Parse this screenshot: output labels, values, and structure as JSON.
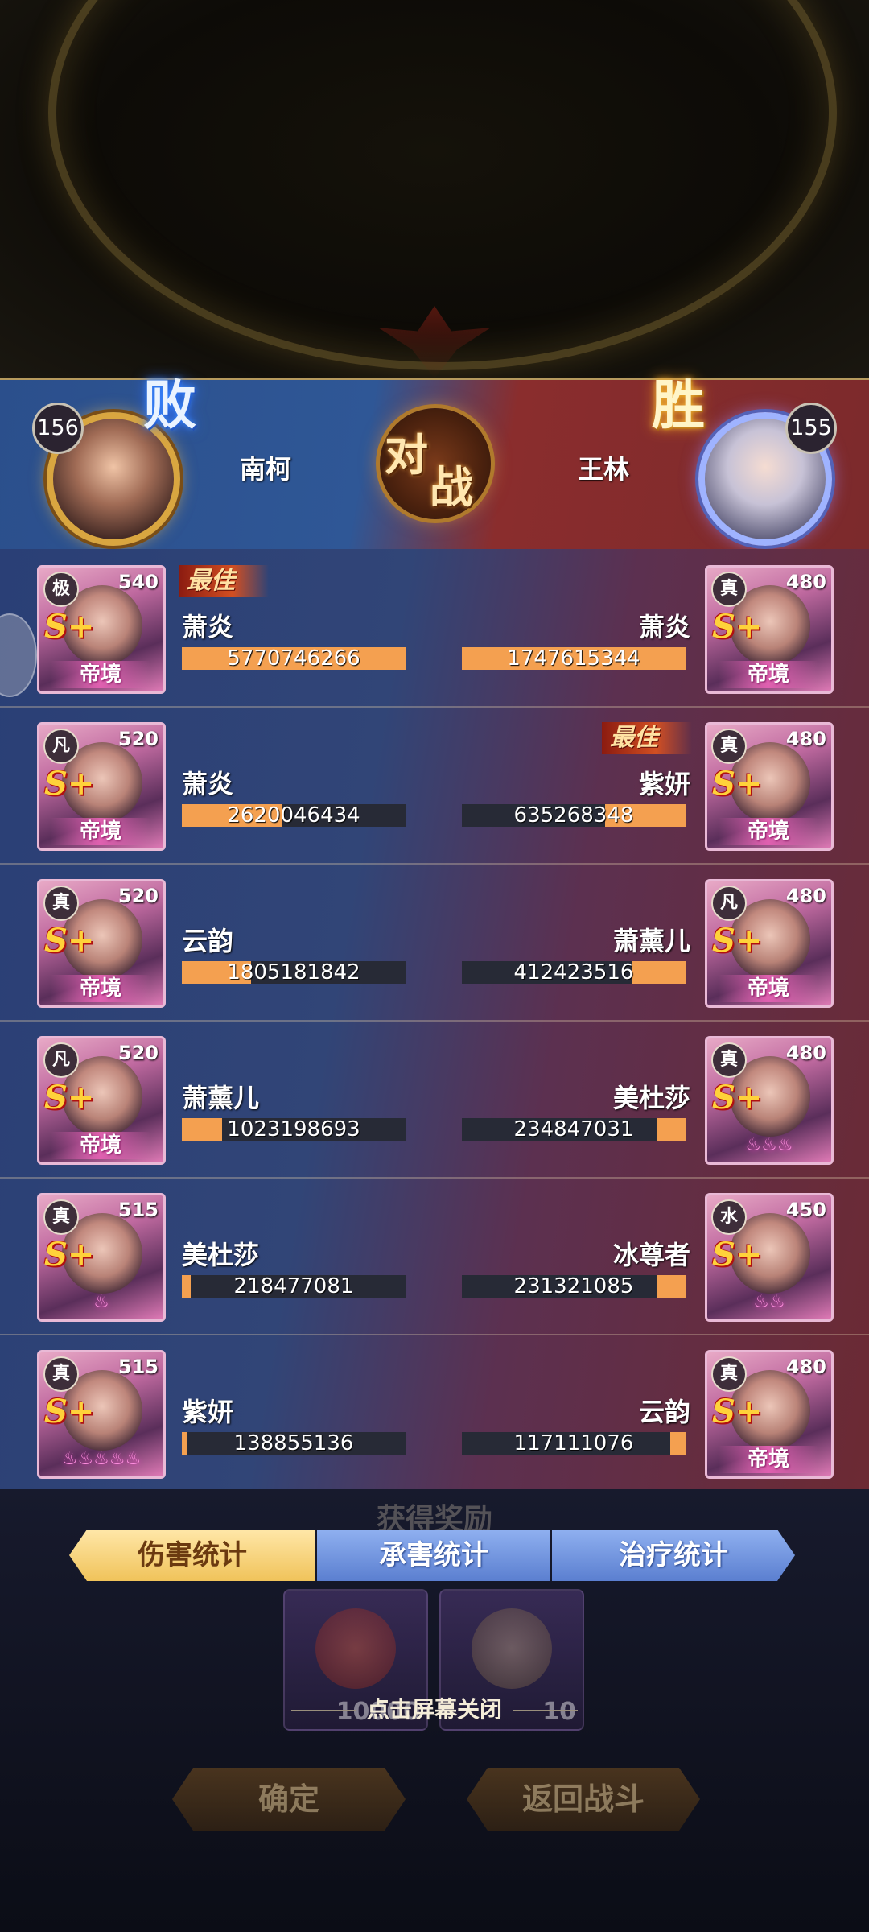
{
  "header": {
    "left": {
      "name": "南柯",
      "level": "156",
      "result": "败"
    },
    "right": {
      "name": "王林",
      "level": "155",
      "result": "胜"
    },
    "versus": [
      "对",
      "战"
    ]
  },
  "rows": [
    {
      "left": {
        "rank": "极",
        "level": "540",
        "grade": "S+",
        "realm": "帝境",
        "name": "萧炎",
        "value": "5770746266",
        "fill": 1.0,
        "best": "最佳"
      },
      "right": {
        "rank": "真",
        "level": "480",
        "grade": "S+",
        "realm": "帝境",
        "name": "萧炎",
        "value": "1747615344",
        "fill": 1.0,
        "best": ""
      }
    },
    {
      "left": {
        "rank": "凡",
        "level": "520",
        "grade": "S+",
        "realm": "帝境",
        "name": "萧炎",
        "value": "2620046434",
        "fill": 0.45,
        "best": ""
      },
      "right": {
        "rank": "真",
        "level": "480",
        "grade": "S+",
        "realm": "帝境",
        "name": "紫妍",
        "value": "635268348",
        "fill": 0.36,
        "best": "最佳"
      }
    },
    {
      "left": {
        "rank": "真",
        "level": "520",
        "grade": "S+",
        "realm": "帝境",
        "name": "云韵",
        "value": "1805181842",
        "fill": 0.31,
        "best": ""
      },
      "right": {
        "rank": "凡",
        "level": "480",
        "grade": "S+",
        "realm": "帝境",
        "name": "萧薰儿",
        "value": "412423516",
        "fill": 0.24,
        "best": ""
      }
    },
    {
      "left": {
        "rank": "凡",
        "level": "520",
        "grade": "S+",
        "realm": "帝境",
        "name": "萧薰儿",
        "value": "1023198693",
        "fill": 0.18,
        "best": ""
      },
      "right": {
        "rank": "真",
        "level": "480",
        "grade": "S+",
        "realm": "",
        "name": "美杜莎",
        "value": "234847031",
        "fill": 0.13,
        "best": ""
      }
    },
    {
      "left": {
        "rank": "真",
        "level": "515",
        "grade": "S+",
        "realm": "",
        "name": "美杜莎",
        "value": "218477081",
        "fill": 0.04,
        "best": ""
      },
      "right": {
        "rank": "水",
        "level": "450",
        "grade": "S+",
        "realm": "",
        "name": "冰尊者",
        "value": "231321085",
        "fill": 0.13,
        "best": ""
      }
    },
    {
      "left": {
        "rank": "真",
        "level": "515",
        "grade": "S+",
        "realm": "",
        "name": "紫妍",
        "value": "138855136",
        "fill": 0.02,
        "best": ""
      },
      "right": {
        "rank": "真",
        "level": "480",
        "grade": "S+",
        "realm": "帝境",
        "name": "云韵",
        "value": "117111076",
        "fill": 0.07,
        "best": ""
      }
    }
  ],
  "flame_glyphs": [
    "♨",
    "♨♨♨",
    "♨♨",
    "♨♨♨♨♨"
  ],
  "tabs": {
    "damage": "伤害统计",
    "tank": "承害统计",
    "heal": "治疗统计"
  },
  "rewards": {
    "title": "获得奖励",
    "items": [
      {
        "count": "10000"
      },
      {
        "count": "10"
      }
    ]
  },
  "close_hint": "点击屏幕关闭",
  "buttons": {
    "confirm": "确定",
    "return_battle": "返回战斗"
  },
  "colors": {
    "bar_fill": "#f4a050",
    "bar_track": "#272a36",
    "left_team": "#2f5796",
    "right_team": "#7c2a2c"
  }
}
